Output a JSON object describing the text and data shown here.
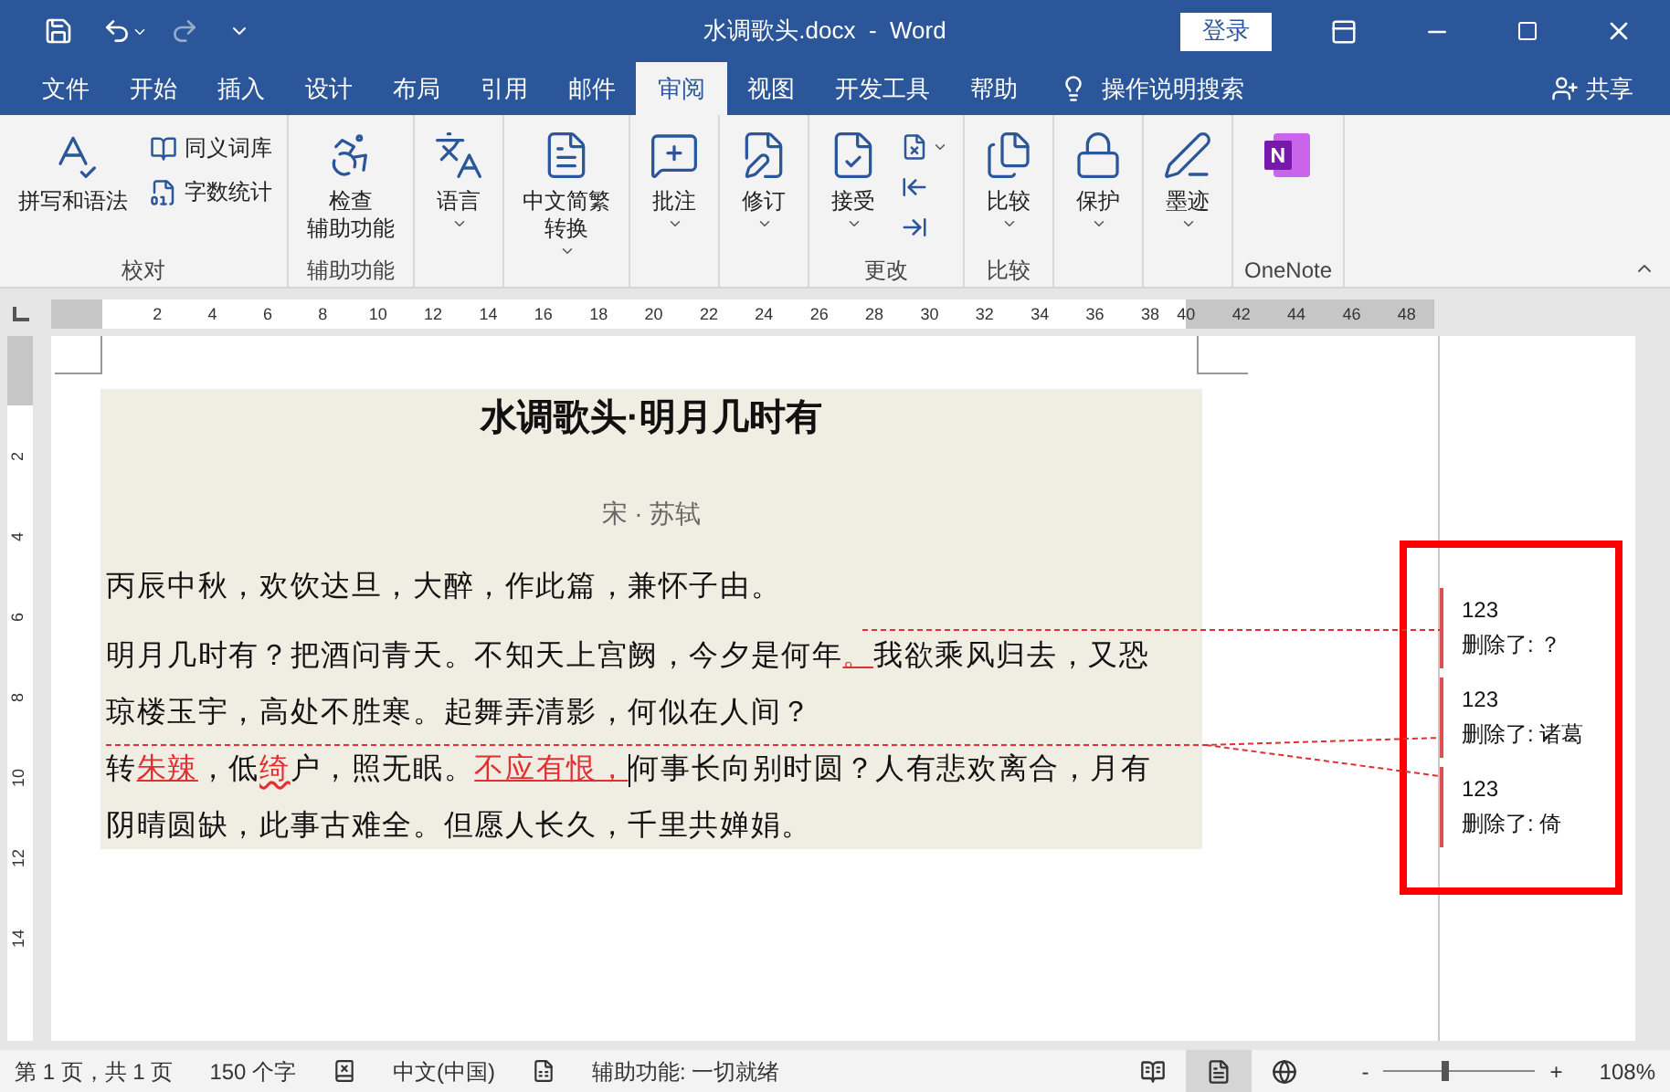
{
  "window": {
    "title": "水调歌头.docx  -  Word",
    "signin": "登录"
  },
  "tabs": [
    {
      "label": "文件",
      "selected": false
    },
    {
      "label": "开始",
      "selected": false
    },
    {
      "label": "插入",
      "selected": false
    },
    {
      "label": "设计",
      "selected": false
    },
    {
      "label": "布局",
      "selected": false
    },
    {
      "label": "引用",
      "selected": false
    },
    {
      "label": "邮件",
      "selected": false
    },
    {
      "label": "审阅",
      "selected": true
    },
    {
      "label": "视图",
      "selected": false
    },
    {
      "label": "开发工具",
      "selected": false
    },
    {
      "label": "帮助",
      "selected": false
    }
  ],
  "tell_me": "操作说明搜索",
  "share": "共享",
  "ribbon": [
    {
      "label": "校对",
      "buttons": [
        {
          "kind": "large",
          "lines": [
            "拼写和语法"
          ],
          "dropdown": false
        },
        {
          "kind": "small",
          "lines": [
            "同义词库"
          ],
          "dropdown": false
        },
        {
          "kind": "small",
          "lines": [
            "字数统计"
          ],
          "dropdown": false
        }
      ]
    },
    {
      "label": "辅助功能",
      "buttons": [
        {
          "kind": "large",
          "lines": [
            "检查",
            "辅助功能"
          ],
          "dropdown": false
        }
      ]
    },
    {
      "buttons": [
        {
          "kind": "large",
          "lines": [
            "语言"
          ],
          "dropdown": true
        }
      ]
    },
    {
      "buttons": [
        {
          "kind": "large",
          "lines": [
            "中文简繁",
            "转换"
          ],
          "dropdown": true
        }
      ]
    },
    {
      "buttons": [
        {
          "kind": "large",
          "lines": [
            "批注"
          ],
          "dropdown": true
        }
      ]
    },
    {
      "buttons": [
        {
          "kind": "large",
          "lines": [
            "修订"
          ],
          "dropdown": true
        }
      ]
    },
    {
      "label": "更改",
      "buttons": [
        {
          "kind": "large",
          "lines": [
            "接受"
          ],
          "dropdown": true
        },
        {
          "kind": "icon",
          "dropdown": true
        },
        {
          "kind": "icon",
          "dropdown": false
        },
        {
          "kind": "icon",
          "dropdown": false
        }
      ]
    },
    {
      "label": "比较",
      "buttons": [
        {
          "kind": "large",
          "lines": [
            "比较"
          ],
          "dropdown": true
        }
      ]
    },
    {
      "buttons": [
        {
          "kind": "large",
          "lines": [
            "保护"
          ],
          "dropdown": true
        }
      ]
    },
    {
      "buttons": [
        {
          "kind": "large",
          "lines": [
            "墨迹"
          ],
          "dropdown": true
        }
      ]
    },
    {
      "label": "OneNote",
      "buttons": [
        {
          "kind": "icon_large",
          "dropdown": false
        }
      ]
    }
  ],
  "ruler": {
    "numbers": [
      "2",
      "4",
      "6",
      "8",
      "10",
      "12",
      "14",
      "16",
      "18",
      "20",
      "22",
      "24",
      "26",
      "28",
      "30",
      "32",
      "34",
      "36",
      "38",
      "40",
      "42",
      "44",
      "46",
      "48"
    ],
    "vertical_numbers": [
      "2",
      "4",
      "6",
      "8",
      "10",
      "12",
      "14"
    ]
  },
  "document": {
    "title": "水调歌头·明月几时有",
    "author": "宋 · 苏轼",
    "paragraphs": [
      {
        "lines": [
          [
            {
              "kind": "plain",
              "text": "丙辰中秋，欢饮达旦，大醉，作此篇，兼怀子由。"
            }
          ]
        ]
      },
      {
        "lines": [
          [
            {
              "kind": "plain",
              "text": "明月几时有？把酒问青天。不知天上宫阙，今夕是何年"
            },
            {
              "kind": "insert",
              "text": "。"
            },
            {
              "kind": "plain",
              "text": "我欲乘风归去，又恐"
            }
          ],
          [
            {
              "kind": "plain",
              "text": "琼楼玉宇，高处不胜寒。起舞弄清影，何似在人间？"
            }
          ],
          [
            {
              "kind": "plain",
              "text": "转"
            },
            {
              "kind": "insert",
              "text": "朱辣"
            },
            {
              "kind": "plain",
              "text": "，低"
            },
            {
              "kind": "insert_flagged",
              "text": "绮"
            },
            {
              "kind": "plain",
              "text": "户，照无眠。"
            },
            {
              "kind": "insert",
              "text": "不应有恨，"
            },
            {
              "kind": "cursor"
            },
            {
              "kind": "plain",
              "text": "何事长向别时圆？人有悲欢离合，月有"
            }
          ],
          [
            {
              "kind": "plain",
              "text": "阴晴圆缺，此事古难全。但愿人长久，千里共婵娟。"
            }
          ]
        ]
      }
    ]
  },
  "comments": [
    {
      "author": "123",
      "text": "删除了: ？"
    },
    {
      "author": "123",
      "text": "删除了: 诸葛"
    },
    {
      "author": "123",
      "text": "删除了: 倚"
    }
  ],
  "status_bar": {
    "page": "第 1 页，共 1 页",
    "words": "150 个字",
    "language": "中文(中国)",
    "accessibility": "辅助功能: 一切就绪",
    "views": [
      {
        "kind": "read",
        "selected": false
      },
      {
        "kind": "print",
        "selected": true
      },
      {
        "kind": "web",
        "selected": false
      }
    ],
    "zoom_out": "-",
    "zoom_in": "+",
    "zoom": {
      "level": 0.41
    },
    "zoom_text": "108%"
  }
}
